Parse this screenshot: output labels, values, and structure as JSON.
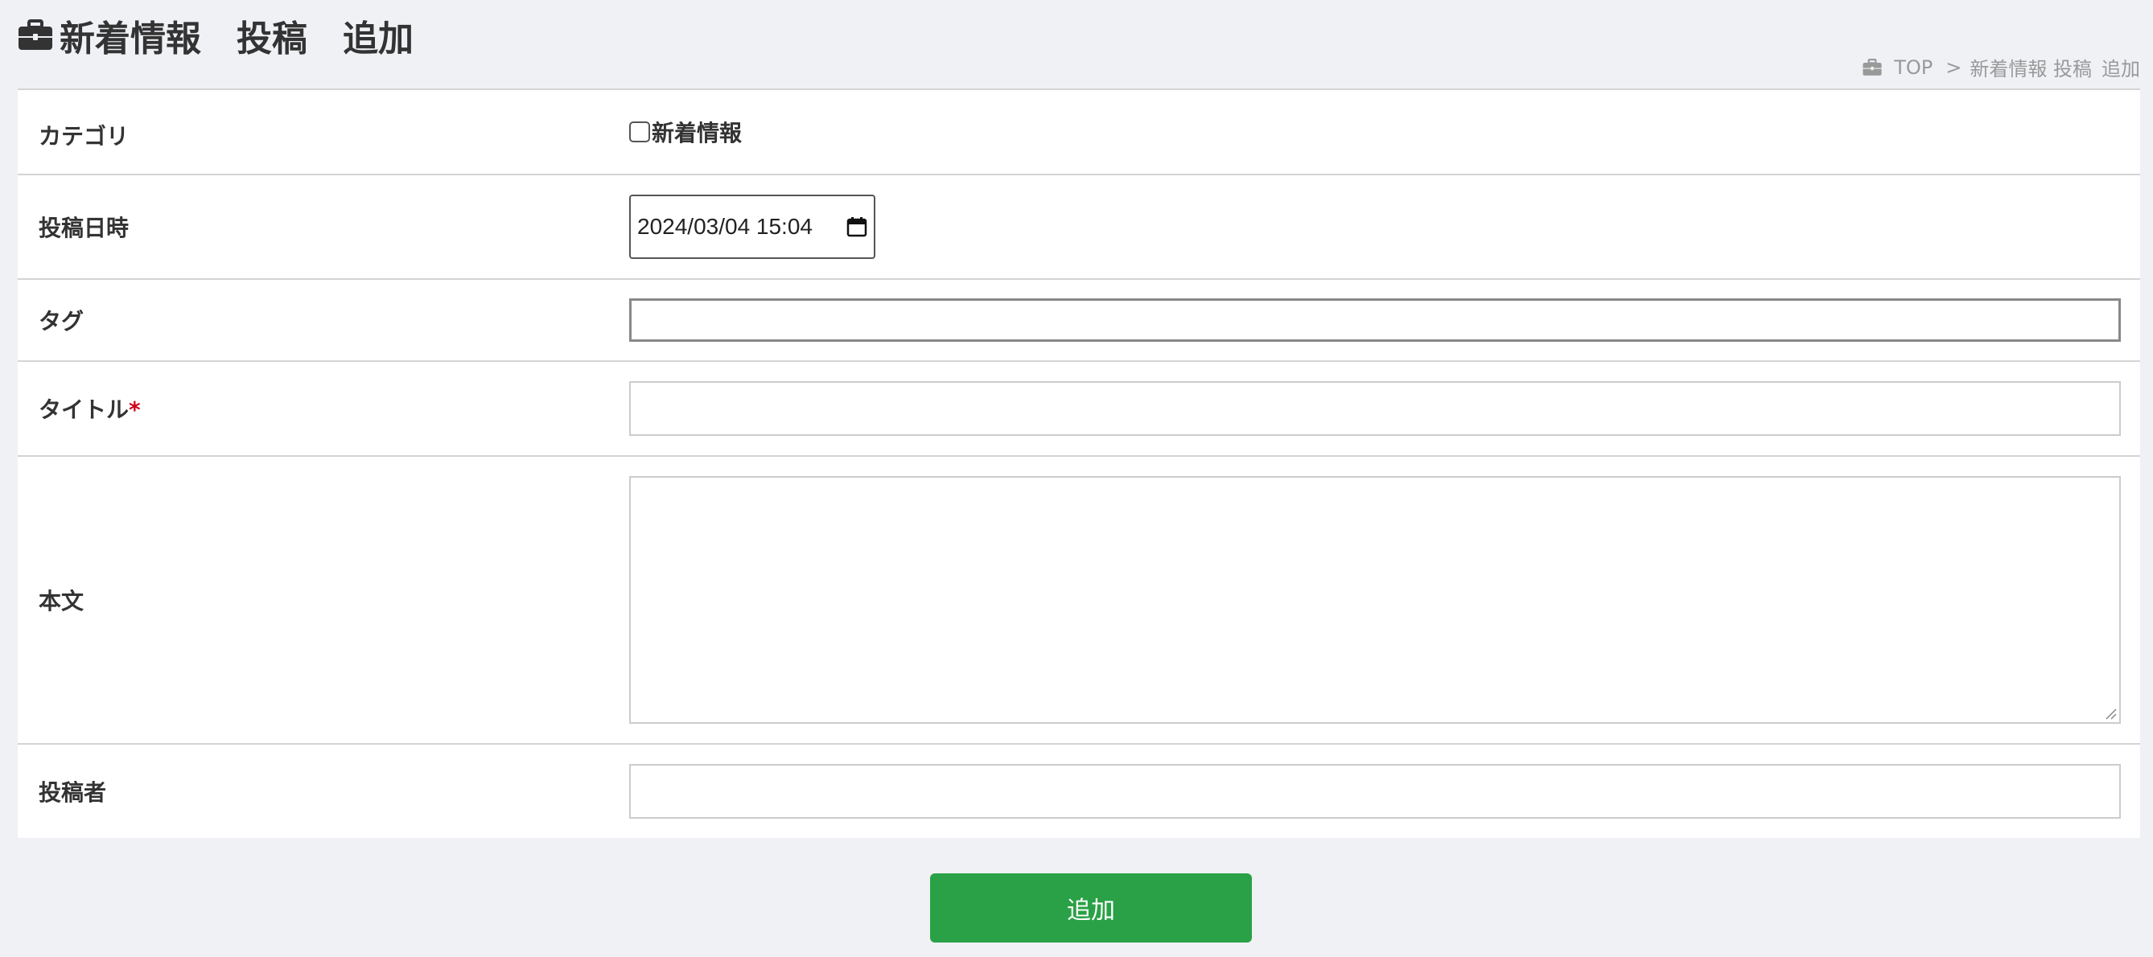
{
  "header": {
    "icon": "briefcase-icon",
    "title_parts": [
      "新着情報",
      "投稿",
      "追加"
    ]
  },
  "breadcrumb": {
    "icon": "briefcase-icon",
    "home": "TOP",
    "separator": ">",
    "section": "新着情報 投稿",
    "current": "追加"
  },
  "form": {
    "category": {
      "label": "カテゴリ",
      "option_label": "新着情報",
      "checked": false
    },
    "post_date": {
      "label": "投稿日時",
      "value": "2024/03/04 15:04",
      "icon": "calendar-icon"
    },
    "tag": {
      "label": "タグ",
      "value": ""
    },
    "title": {
      "label": "タイトル",
      "required_mark": "*",
      "value": ""
    },
    "body": {
      "label": "本文",
      "value": ""
    },
    "author": {
      "label": "投稿者",
      "value": ""
    }
  },
  "submit": {
    "label": "追加",
    "color": "#2aa146"
  },
  "colors": {
    "background": "#eff1f5",
    "required": "#d0021b"
  }
}
